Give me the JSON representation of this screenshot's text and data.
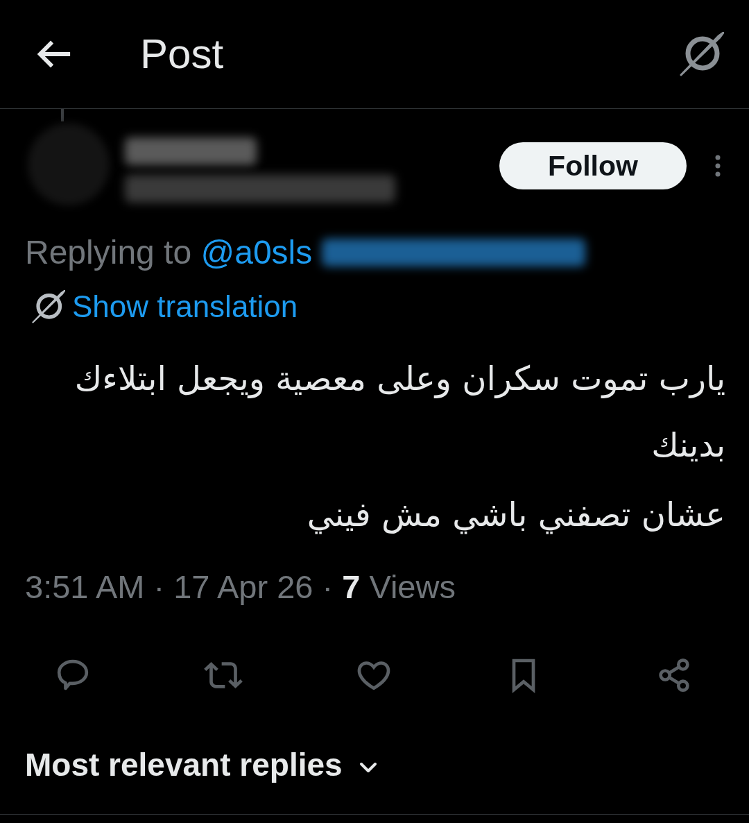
{
  "header": {
    "title": "Post"
  },
  "post": {
    "follow_label": "Follow",
    "replying_to": {
      "label": "Replying to",
      "handle": "@a0sls"
    },
    "translation_link": "Show translation",
    "paragraphs": [
      "يارب تموت سكران وعلى معصية ويجعل ابتلاءك بدينك",
      "عشان تصفني باشي مش فيني"
    ],
    "meta": "3:51 AM · 17 Apr 26 · **7** Views",
    "actions": [
      {
        "kind": "reply"
      },
      {
        "kind": "repost"
      },
      {
        "kind": "like"
      },
      {
        "kind": "bookmark"
      },
      {
        "kind": "share"
      }
    ]
  },
  "replies_sort": {
    "label": "Most relevant replies"
  }
}
